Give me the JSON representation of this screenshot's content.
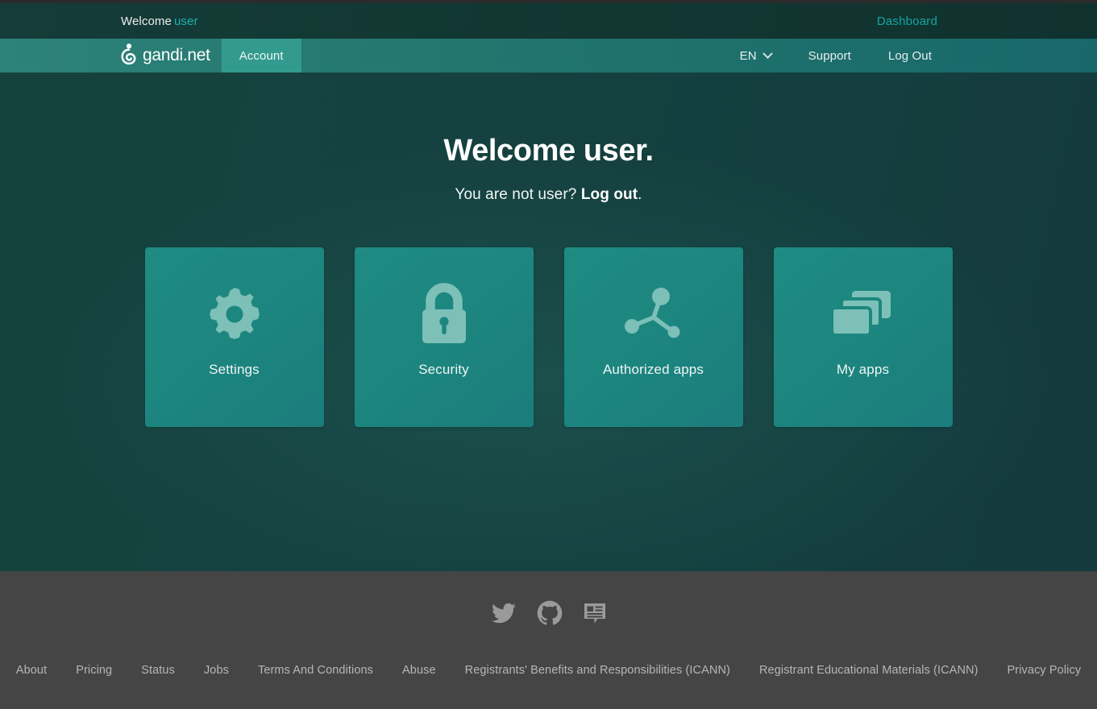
{
  "utility_bar": {
    "welcome_prefix": "Welcome",
    "username": "user",
    "dashboard_label": "Dashboard"
  },
  "navbar": {
    "brand_text": "gandi.net",
    "brand_icon": "gandi-logo-icon",
    "active_tab": "Account",
    "language": "EN",
    "language_caret_icon": "chevron-down-icon",
    "support_label": "Support",
    "logout_label": "Log Out"
  },
  "hero": {
    "title": "Welcome user.",
    "sub_prefix": "You are not user?",
    "sub_link": "Log out",
    "sub_suffix": ".",
    "cards": [
      {
        "label": "Settings",
        "icon": "gear-icon"
      },
      {
        "label": "Security",
        "icon": "lock-icon"
      },
      {
        "label": "Authorized apps",
        "icon": "network-share-icon"
      },
      {
        "label": "My apps",
        "icon": "stacked-windows-icon"
      }
    ]
  },
  "footer": {
    "social": [
      {
        "name": "twitter-icon"
      },
      {
        "name": "github-icon"
      },
      {
        "name": "news-icon"
      }
    ],
    "links": [
      "About",
      "Pricing",
      "Status",
      "Jobs",
      "Terms And Conditions",
      "Abuse",
      "Registrants' Benefits and Responsibilities (ICANN)",
      "Registrant Educational Materials (ICANN)",
      "Privacy Policy"
    ]
  },
  "colors": {
    "accent_cyan": "#19b3ad",
    "dashboard_link": "#14a8a4",
    "nav_active_tab": "#329a8e",
    "card_teal": "#1f8b82",
    "hero_bg": "#154140",
    "footer_bg": "#454545",
    "footer_link": "#b6b6b6",
    "card_icon": "#78bdb5"
  }
}
